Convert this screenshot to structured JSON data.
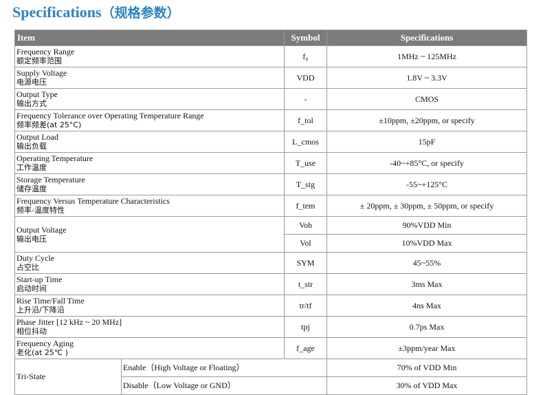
{
  "title": {
    "en": "Specifications",
    "cn": "（规格参数）"
  },
  "table": {
    "headers": [
      "Item",
      "Symbol",
      "Specifications"
    ],
    "rows": [
      {
        "en": "Frequency Range",
        "cn": "额定频率范围",
        "symbol": "f₀",
        "value": "1MHz ~ 125MHz"
      },
      {
        "en": "Supply Voltage",
        "cn": "电源电压",
        "symbol": "VDD",
        "value": "1.8V ~ 3.3V"
      },
      {
        "en": "Output Type",
        "cn": "输出方式",
        "symbol": "-",
        "value": "CMOS"
      },
      {
        "en": "Frequency Tolerance over Operating Temperature Range",
        "cn": "频率频差(at 25°C)",
        "symbol": "f_tol",
        "value": "±10ppm, ±20ppm, or specify"
      },
      {
        "en": "Output Load",
        "cn": "输出负载",
        "symbol": "L_cmos",
        "value": "15pF"
      },
      {
        "en": "Operating Temperature",
        "cn": "工作温度",
        "symbol": "T_use",
        "value": "-40~+85°C, or specify"
      },
      {
        "en": "Storage Temperature",
        "cn": "储存温度",
        "symbol": "T_stg",
        "value": "-55~+125°C"
      },
      {
        "en": "Frequency Versus Temperature Characteristics",
        "cn": "频率-温度特性",
        "symbol": "f_tem",
        "value": "± 20ppm, ± 30ppm, ± 50ppm, or specify"
      }
    ],
    "output_voltage": {
      "en": "Output Voltage",
      "cn": "输出电压",
      "lines": [
        {
          "symbol": "Voh",
          "value": "90%VDD Min"
        },
        {
          "symbol": "Vol",
          "value": "10%VDD Max"
        }
      ]
    },
    "rows2": [
      {
        "en": "Duty Cycle",
        "cn": "占空比",
        "symbol": "SYM",
        "value": "45~55%"
      },
      {
        "en": "Start-up Time",
        "cn": "启动时间",
        "symbol": "t_str",
        "value": "3ms Max"
      },
      {
        "en": "Rise Time/Fall Time",
        "cn": "上升沿/下降沿",
        "symbol": "tr/tf",
        "value": "4ns Max"
      },
      {
        "en": "Phase Jitter [12 kHz ~ 20 MHz]",
        "cn": "相位抖动",
        "symbol": "tpj",
        "value": "0.7ps Max"
      },
      {
        "en": "Frequency Aging",
        "cn": "老化(at 25℃ )",
        "symbol": "f_age",
        "value": "±3ppm/year Max"
      }
    ],
    "tri_state": {
      "label": "Tri-State",
      "options": [
        {
          "condition": "Enable（High Voltage or Floating）",
          "value": "70% of VDD Min"
        },
        {
          "condition": "Disable（Low Voltage or GND）",
          "value": "30% of VDD Max"
        }
      ]
    }
  }
}
